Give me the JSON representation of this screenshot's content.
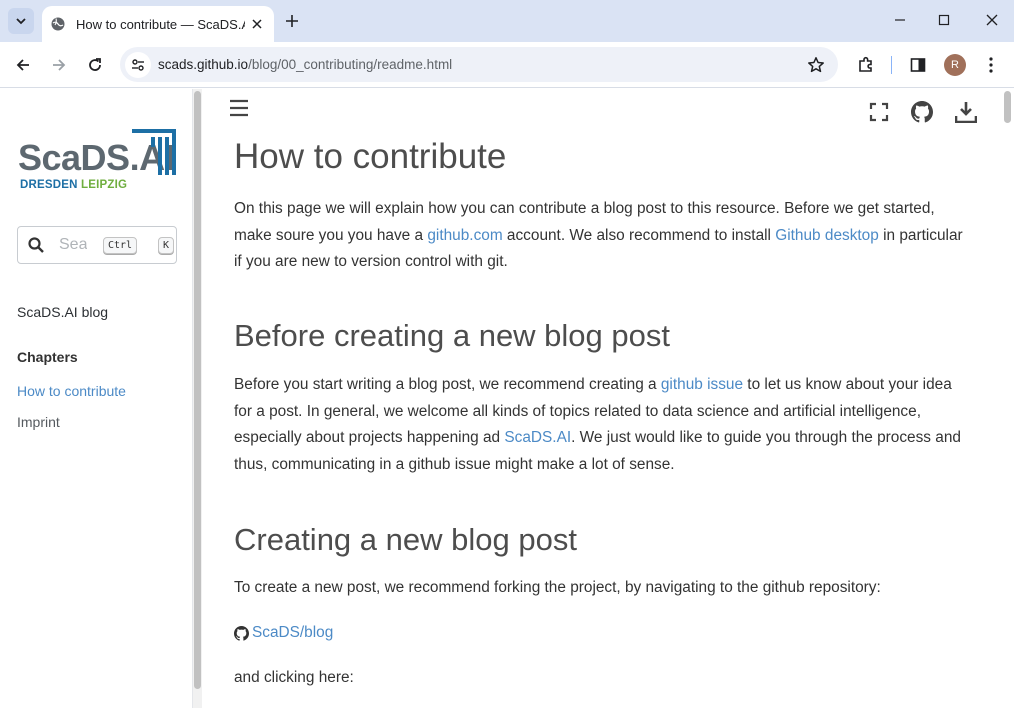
{
  "browser": {
    "tab_title": "How to contribute — ScaDS.AI blog",
    "url_host": "scads.github.io",
    "url_path": "/blog/00_contributing/readme.html",
    "profile_initial": "R",
    "accent": "#dae3f4"
  },
  "sidebar": {
    "logo_text": "ScaDS.AI",
    "logo_city1": "DRESDEN",
    "logo_city2": "LEIPZIG",
    "search_placeholder": "Search this book",
    "kbd_ctrl": "Ctrl",
    "kbd_k": "K",
    "blog_label": "ScaDS.AI blog",
    "chapters_label": "Chapters",
    "items": [
      {
        "label": "How to contribute",
        "active": true
      },
      {
        "label": "Imprint",
        "active": false
      }
    ],
    "active_color": "#4c8ac6"
  },
  "content": {
    "title": "How to contribute",
    "intro_1": "On this page we will explain how you can contribute a blog post to this resource. Before we get started, make soure you you have a ",
    "intro_link1": "github.com",
    "intro_2": " account. We also recommend to install ",
    "intro_link2": "Github desktop",
    "intro_3": " in particular if you are new to version control with git.",
    "section1_title": "Before creating a new blog post",
    "s1_1": "Before you start writing a blog post, we recommend creating a ",
    "s1_link1": "github issue",
    "s1_2": " to let us know about your idea for a post. In general, we welcome all kinds of topics related to data science and artificial intelligence, especially about projects happening ad ",
    "s1_link2": "ScaDS.AI",
    "s1_3": ". We just would like to guide you through the process and thus, communicating in a github issue might make a lot of sense.",
    "section2_title": "Creating a new blog post",
    "s2_p1": "To create a new post, we recommend forking the project, by navigating to the github repository:",
    "s2_repo_link": "ScaDS/blog",
    "s2_p2": "and clicking here:"
  }
}
